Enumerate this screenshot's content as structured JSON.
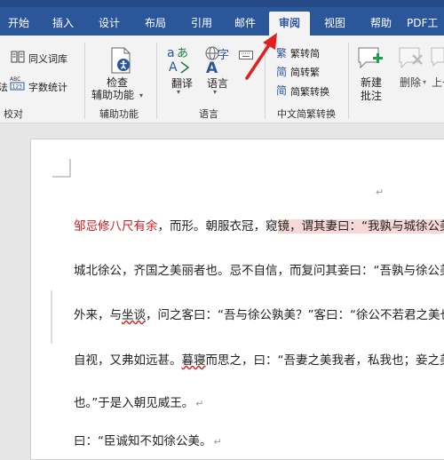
{
  "tabs": [
    {
      "label": "开始"
    },
    {
      "label": "插入"
    },
    {
      "label": "设计"
    },
    {
      "label": "布局"
    },
    {
      "label": "引用"
    },
    {
      "label": "邮件"
    },
    {
      "label": "审阅"
    },
    {
      "label": "视图"
    },
    {
      "label": "帮助"
    },
    {
      "label": "PDF工"
    }
  ],
  "ribbon": {
    "proofing": {
      "thesaurus": "同义词库",
      "word_count": "字数统计",
      "left_partial": "法",
      "group_label": "校对"
    },
    "accessibility": {
      "check_line1": "检查",
      "check_line2": "辅助功能",
      "group_label": "辅助功能"
    },
    "language": {
      "translate": "翻译",
      "language": "语言",
      "group_label": "语言"
    },
    "chinese_conversion": {
      "to_traditional": "繁转简",
      "to_simplified": "简转繁",
      "convert": "简繁转换",
      "group_label": "中文简繁转换"
    },
    "comments": {
      "new_line1": "新建",
      "new_line2": "批注",
      "delete": "删除",
      "prev_partial": "上一"
    }
  },
  "document": {
    "lines": [
      {
        "red": "邹忌修八尺有余",
        "normal": "，而形。朝服衣冠，窥",
        "highlight": "镜，谓其妻曰：“我孰与城徐公美"
      },
      {
        "text": "城北徐公，齐国之美丽者也。忌不自信，而复问其妾曰：“吾孰与徐公美"
      },
      {
        "pre": "外来，与",
        "squiggle": "坐谈",
        "post": "，问之客曰：“吾与徐公孰美？”客曰：“徐公不若君之美也"
      },
      {
        "pre": "自视，又弗如远甚。",
        "squiggle": "暮寝",
        "post": "而思之，曰：“吾妻之美我者，私我也；妾之美"
      },
      {
        "text": "也。”于是入朝见威王。"
      },
      {
        "text": "曰：“臣诚知不如徐公美。"
      }
    ]
  },
  "colors": {
    "ribbon_blue": "#2b579a",
    "red_text": "#d7191c",
    "highlight": "#f8d7d7",
    "arrow": "#e0201c"
  }
}
